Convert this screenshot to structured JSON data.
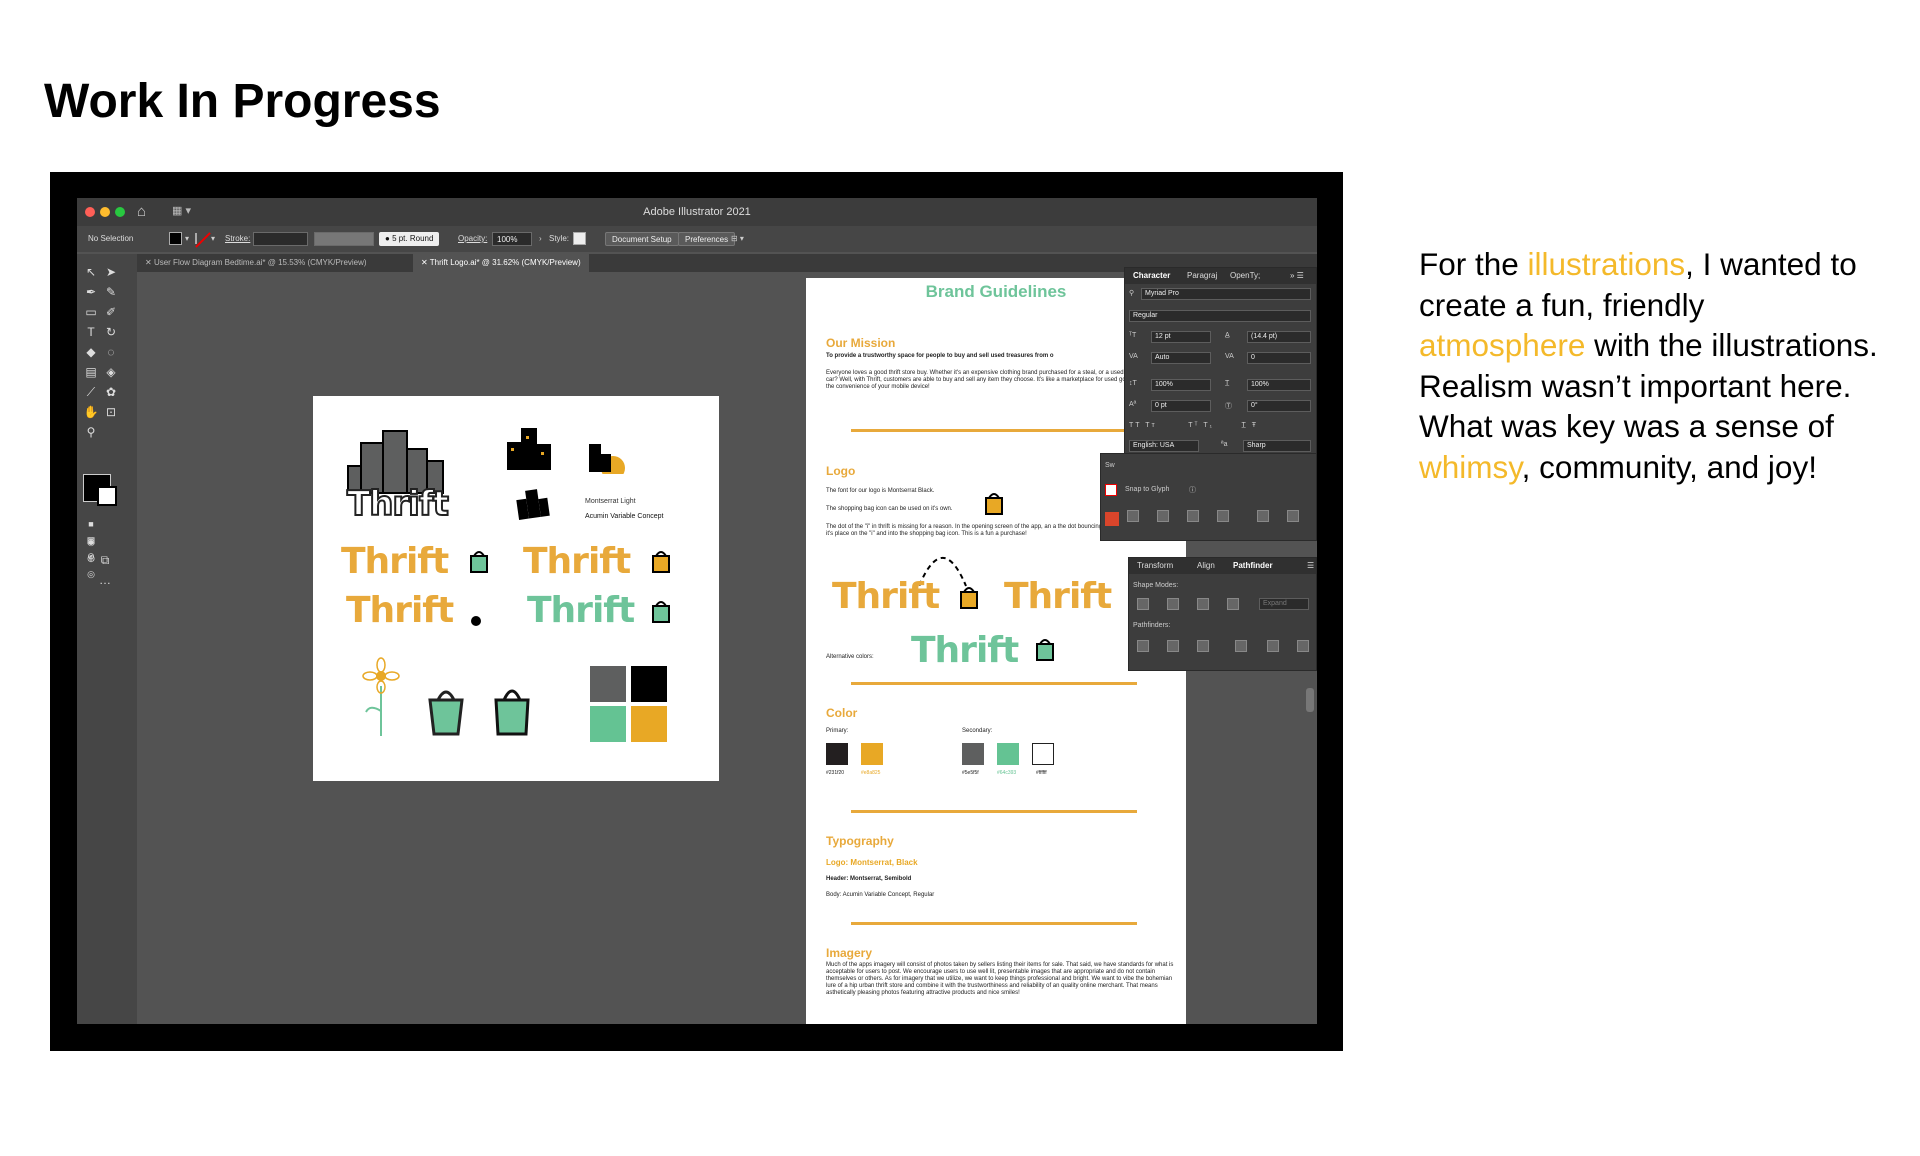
{
  "slide": {
    "title": "Work In Progress",
    "body": {
      "p1": "For the ",
      "h1": "illustrations",
      "p2": ", I wanted to create a fun, friendly ",
      "h2": "atmosphere",
      "p3": " with the illustrations. Realism wasn’t important here. What was key was a sense of ",
      "h3": "whimsy",
      "p4": ", community, and joy!"
    },
    "highlight_color": "#f4b92a"
  },
  "app": {
    "title": "Adobe Illustrator 2021",
    "control_bar": {
      "selection": "No Selection",
      "stroke_label": "Stroke:",
      "brush": "5 pt. Round",
      "opacity_label": "Opacity:",
      "opacity_value": "100%",
      "style_label": "Style:",
      "document_setup": "Document Setup",
      "preferences": "Preferences"
    },
    "tabs": [
      {
        "label": "User Flow Diagram Bedtime.ai* @ 15.53% (CMYK/Preview)",
        "active": false
      },
      {
        "label": "Thrift Logo.ai* @ 31.62% (CMYK/Preview)",
        "active": true
      }
    ]
  },
  "artboard1": {
    "wordmark": "Thrift",
    "font_label_1": "Montserrat Light",
    "font_label_2": "Acumin Variable Concept",
    "palette": [
      "#5e5f5f",
      "#000000",
      "#64c393",
      "#e8a825"
    ]
  },
  "guidelines": {
    "heading": "Brand Guidelines",
    "mission_h": "Our Mission",
    "mission_1": "To provide a trustworthy space for people to buy and sell used treasures from o",
    "mission_2": "Everyone loves a good thrift store buy. Whether it's an expensive clothing brand purchased for a steal, or a used car. Wait- a used car? Well, with Thrift, customers are able to buy and sell any item they choose. It's like a marketplace for used goods all done from the convenience of your mobile device!",
    "logo_h": "Logo",
    "logo_1": "The font for our logo is Montserrat Black.",
    "logo_2": "The shopping bag icon can be used on it's own.",
    "logo_3": "The dot of the \"i\" in thrift is missing for a reason. In the opening screen of the app, an a the dot bouncing from it's place on the \"i\" and into the shopping bag icon. This is a fun a purchase!",
    "alt_colors": "Alternative colors:",
    "wordmark": "Thrift",
    "color_h": "Color",
    "primary": "Primary:",
    "secondary": "Secondary:",
    "primary_colors": [
      {
        "hex": "#231f20",
        "label": "#231f20"
      },
      {
        "hex": "#e8a825",
        "label": "#e8a825"
      }
    ],
    "secondary_colors": [
      {
        "hex": "#5e5f5f",
        "label": "#5e5f5f"
      },
      {
        "hex": "#64c393",
        "label": "#64c393"
      },
      {
        "hex": "#ffffff",
        "label": "#ffffff"
      }
    ],
    "type_h": "Typography",
    "type_logo": "Logo: Montserrat, Black",
    "type_header": "Header: Montserrat, Semibold",
    "type_body": "Body: Acumin Variable Concept, Regular",
    "imagery_h": "Imagery",
    "imagery_text": "Much of the apps imagery will consist of photos taken by sellers listing their items for sale. That said, we have standards for what is acceptable for users to post. We encourage users to use well lit, presentable images that are appropriate and do not contain themselves or others. As for imagery that we utilize, we want to keep things professional and bright. We want to vibe the bohemian lure of a hip urban thrift store and combine it with the trustworthiness and reliability of an quality online merchant. That means asthetically pleasing photos featuring attractive products and nice smiles!"
  },
  "character_panel": {
    "tabs": [
      "Character",
      "Paragraj",
      "OpenTy;"
    ],
    "font": "Myriad Pro",
    "style": "Regular",
    "size": "12 pt",
    "leading": "(14.4 pt)",
    "kerning": "Auto",
    "tracking": "0",
    "vscale": "100%",
    "hscale": "100%",
    "baseline": "0 pt",
    "rotation": "0°",
    "language": "English: USA",
    "aa": "Sharp",
    "snap": "Snap to Glyph"
  },
  "pathfinder_panel": {
    "tabs": [
      "Transform",
      "Align",
      "Pathfinder"
    ],
    "shape_modes": "Shape Modes:",
    "expand": "Expand",
    "pathfinders": "Pathfinders:"
  },
  "swatches_tab": "Sw"
}
